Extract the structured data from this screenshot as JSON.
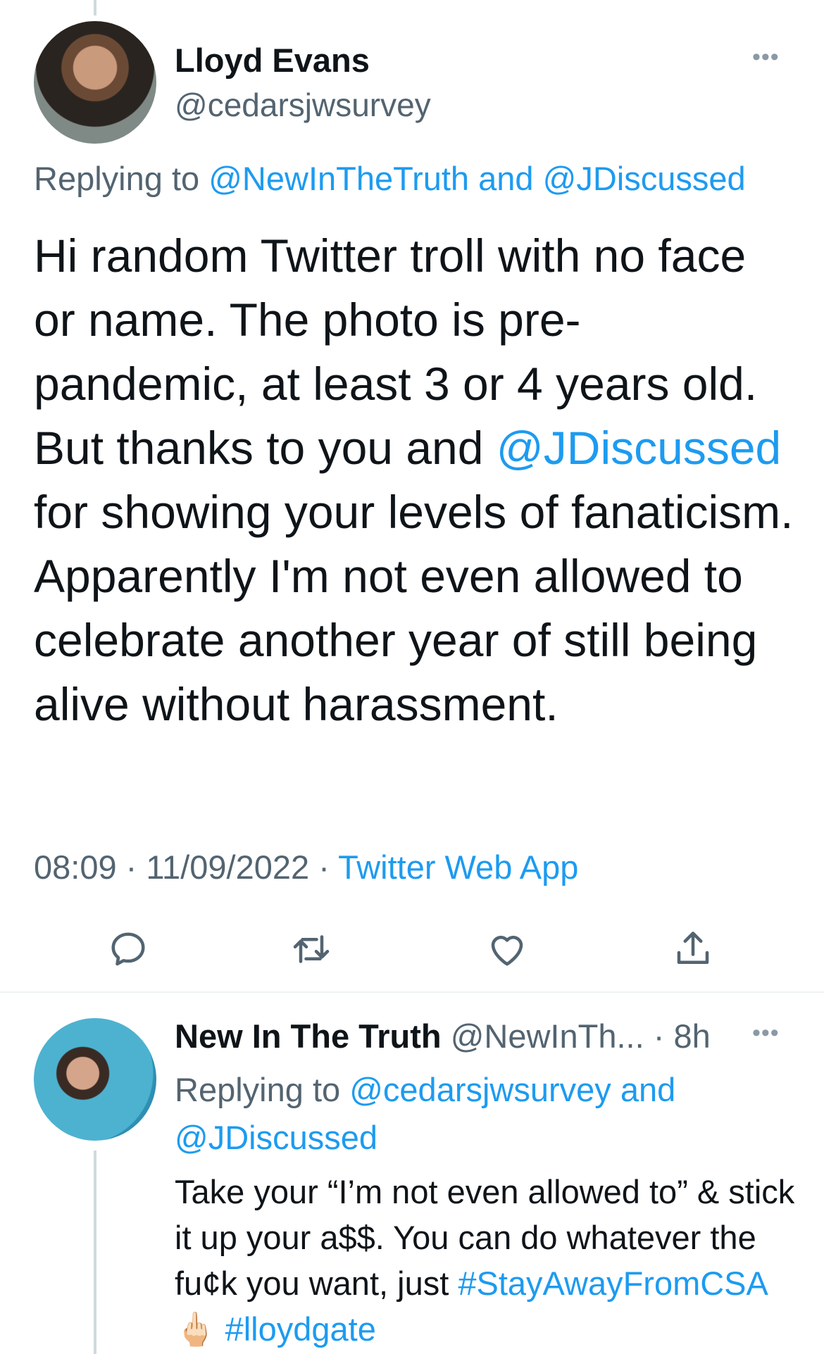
{
  "tweet": {
    "author_name": "Lloyd Evans",
    "author_handle": "@cedarsjwsurvey",
    "replying_prefix": "Replying to ",
    "replying_to_1": "@NewInTheTruth",
    "replying_and": " and ",
    "replying_to_2": "@JDiscussed",
    "text_part1": "Hi random Twitter troll with no face or name. The photo is pre-pandemic, at least 3 or 4 years old. But thanks to you and ",
    "text_mention": "@JDiscussed",
    "text_part2": " for showing your levels of fanaticism. Apparently I'm not even allowed to celebrate another year of still being alive without harassment.",
    "time": "08:09",
    "date": "11/09/2022",
    "source": "Twitter Web App",
    "separator": " · ",
    "more_icon": "more-horizontal-icon"
  },
  "actions": [
    {
      "name": "reply",
      "icon": "reply-icon"
    },
    {
      "name": "retweet",
      "icon": "retweet-icon"
    },
    {
      "name": "like",
      "icon": "heart-icon"
    },
    {
      "name": "share",
      "icon": "share-icon"
    }
  ],
  "reply": {
    "author_name": "New In The Truth",
    "author_handle": "@NewInTh...",
    "age": "8h",
    "separator": " · ",
    "replying_prefix": "Replying to ",
    "replying_to_1": "@cedarsjwsurvey",
    "replying_and": " and",
    "replying_to_2": "@JDiscussed",
    "text": "Take your “I’m not even allowed to” & stick it up your a$$. You can do whatever the fu¢k you want, just ",
    "hashtag_1": "#StayAwayFromCSA",
    "emoji": " 🖕🏻 ",
    "hashtag_2": "#lloydgate"
  },
  "colors": {
    "link": "#1d9bf0",
    "secondary": "#536471",
    "text": "#0f1419"
  }
}
